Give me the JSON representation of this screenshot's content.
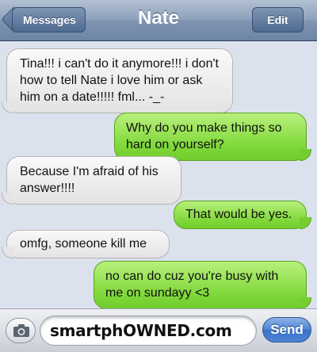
{
  "header": {
    "back_label": "Messages",
    "title": "Nate",
    "edit_label": "Edit"
  },
  "messages": [
    {
      "side": "left",
      "text": "Tina!!! i can't do it anymore!!! i don't how to tell Nate i love him or ask him on a date!!!!! fml... -_-"
    },
    {
      "side": "right",
      "text": "Why do you make things so hard on yourself?"
    },
    {
      "side": "left",
      "text": "Because I'm afraid of his answer!!!!"
    },
    {
      "side": "right",
      "text": "That would be yes."
    },
    {
      "side": "left",
      "text": "omfg, someone kill me"
    },
    {
      "side": "right",
      "text": "no can do cuz you're busy with me on sundayy <3"
    }
  ],
  "composer": {
    "camera_icon": "camera-icon",
    "field_text": "smartphOWNED.com",
    "send_label": "Send"
  },
  "colors": {
    "header": "#8ea2bc",
    "background": "#dbe2ed",
    "incoming_bubble": "#ebebeb",
    "outgoing_bubble": "#80d83a",
    "send_button": "#4d82d4"
  }
}
